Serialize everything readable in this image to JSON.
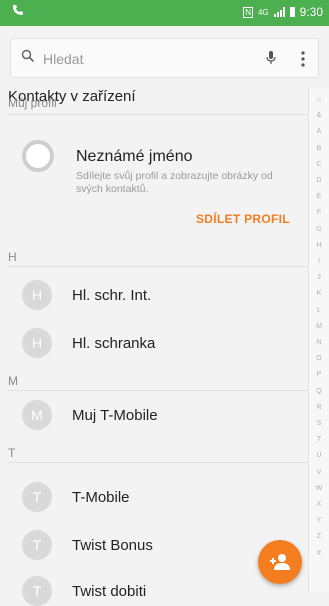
{
  "status": {
    "time": "9:30",
    "left_icon": "phone-icon",
    "nfc_label": "N",
    "network_label": "4G"
  },
  "search": {
    "placeholder": "Hledat"
  },
  "section": {
    "title": "Kontakty v zařízení"
  },
  "profile": {
    "header": "Můj profil",
    "name": "Neznámé jméno",
    "description": "Sdílejte svůj profil a zobrazujte obrázky od svých kontaktů.",
    "share_label": "SDÍLET PROFIL"
  },
  "groups": [
    {
      "letter": "H",
      "contacts": [
        {
          "initial": "H",
          "name": "Hl. schr. Int."
        },
        {
          "initial": "H",
          "name": "Hl. schranka"
        }
      ]
    },
    {
      "letter": "M",
      "contacts": [
        {
          "initial": "M",
          "name": "Muj T-Mobile"
        }
      ]
    },
    {
      "letter": "T",
      "contacts": [
        {
          "initial": "T",
          "name": "T-Mobile"
        },
        {
          "initial": "T",
          "name": "Twist Bonus"
        },
        {
          "initial": "T",
          "name": "Twist dobiti"
        }
      ]
    }
  ],
  "index_letters": [
    "☆",
    "&",
    "A",
    "B",
    "C",
    "D",
    "E",
    "F",
    "G",
    "H",
    "I",
    "J",
    "K",
    "L",
    "M",
    "N",
    "O",
    "P",
    "Q",
    "R",
    "S",
    "T",
    "U",
    "V",
    "W",
    "X",
    "Y",
    "Z",
    "#"
  ],
  "colors": {
    "status_bar": "#4caf50",
    "accent": "#f47d20"
  }
}
